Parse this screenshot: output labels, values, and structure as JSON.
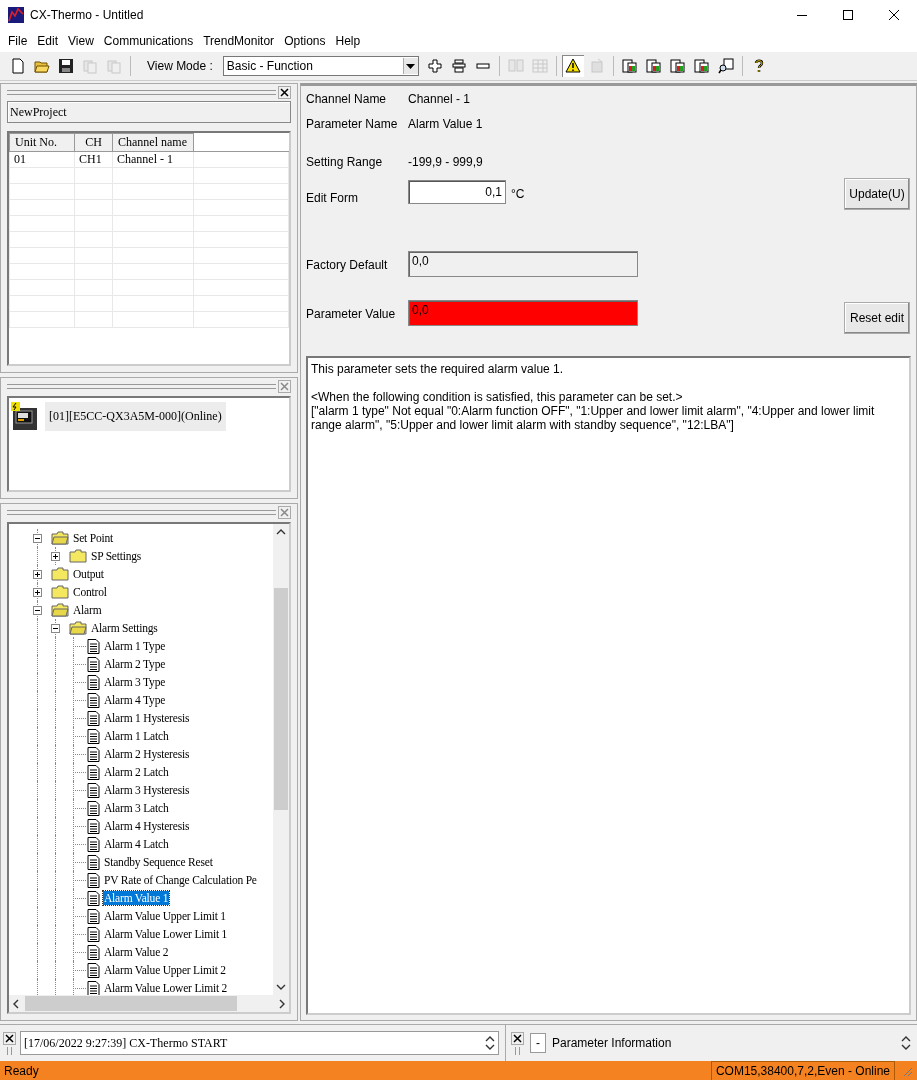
{
  "window": {
    "title": "CX-Thermo - Untitled"
  },
  "menu": [
    {
      "label": "File"
    },
    {
      "label": "Edit"
    },
    {
      "label": "View"
    },
    {
      "label": "Communications"
    },
    {
      "label": "TrendMonitor"
    },
    {
      "label": "Options"
    },
    {
      "label": "Help"
    }
  ],
  "toolbar": {
    "left": [
      {
        "kind": "new",
        "disabled": false
      },
      {
        "kind": "open",
        "disabled": false
      },
      {
        "kind": "save",
        "disabled": false
      },
      {
        "kind": "copy",
        "disabled": true
      },
      {
        "kind": "paste",
        "disabled": true
      }
    ],
    "view_mode_label": "View Mode :",
    "view_mode": "Basic - Function",
    "right": [
      {
        "kind": "plus",
        "disabled": false
      },
      {
        "kind": "stack",
        "disabled": false
      },
      {
        "kind": "minus",
        "disabled": false
      },
      {
        "kind": "split",
        "disabled": true
      },
      {
        "kind": "grid",
        "disabled": true
      },
      {
        "kind": "warning",
        "disabled": false
      },
      {
        "kind": "chip",
        "disabled": true
      },
      {
        "kind": "doc",
        "disabled": false
      },
      {
        "kind": "doc",
        "disabled": false
      },
      {
        "kind": "doc",
        "disabled": false
      },
      {
        "kind": "doc",
        "disabled": false
      },
      {
        "kind": "find",
        "disabled": false
      },
      {
        "kind": "help",
        "disabled": false
      }
    ]
  },
  "project": {
    "name": "NewProject"
  },
  "unit_table": {
    "columns": [
      "Unit No.",
      "CH",
      "Channel name"
    ],
    "rows": [
      [
        "01",
        "CH1",
        "Channel - 1"
      ]
    ]
  },
  "device": {
    "label": "[01][E5CC-QX3A5M-000](Online)"
  },
  "tree": [
    {
      "label": "Set Point",
      "expanded": true,
      "selected": false,
      "children": [
        {
          "label": "SP Settings",
          "expanded": false,
          "selected": false
        }
      ]
    },
    {
      "label": "Output",
      "expanded": false,
      "selected": false
    },
    {
      "label": "Control",
      "expanded": false,
      "selected": false
    },
    {
      "label": "Alarm",
      "expanded": true,
      "selected": false,
      "children": [
        {
          "label": "Alarm Settings",
          "expanded": true,
          "selected": false,
          "children": [
            {
              "label": "Alarm 1 Type",
              "selected": false
            },
            {
              "label": "Alarm 2 Type",
              "selected": false
            },
            {
              "label": "Alarm 3 Type",
              "selected": false
            },
            {
              "label": "Alarm 4 Type",
              "selected": false
            },
            {
              "label": "Alarm 1 Hysteresis",
              "selected": false
            },
            {
              "label": "Alarm 1 Latch",
              "selected": false
            },
            {
              "label": "Alarm 2 Hysteresis",
              "selected": false
            },
            {
              "label": "Alarm 2 Latch",
              "selected": false
            },
            {
              "label": "Alarm 3 Hysteresis",
              "selected": false
            },
            {
              "label": "Alarm 3 Latch",
              "selected": false
            },
            {
              "label": "Alarm 4 Hysteresis",
              "selected": false
            },
            {
              "label": "Alarm 4 Latch",
              "selected": false
            },
            {
              "label": "Standby Sequence Reset",
              "selected": false
            },
            {
              "label": "PV Rate of Change Calculation Pe",
              "selected": false
            },
            {
              "label": "Alarm Value 1",
              "selected": true
            },
            {
              "label": "Alarm Value Upper Limit 1",
              "selected": false
            },
            {
              "label": "Alarm Value Lower Limit 1",
              "selected": false
            },
            {
              "label": "Alarm Value 2",
              "selected": false
            },
            {
              "label": "Alarm Value Upper Limit 2",
              "selected": false
            },
            {
              "label": "Alarm Value Lower Limit 2",
              "selected": false
            }
          ]
        }
      ]
    }
  ],
  "parameter_fields": [
    {
      "kind": "text",
      "label": "Channel Name",
      "value": "Channel - 1"
    },
    {
      "kind": "text",
      "label": "Parameter Name",
      "value": "Alarm Value 1"
    },
    {
      "kind": "text",
      "label": "Setting Range",
      "value": "-199,9 - 999,9"
    },
    {
      "kind": "input",
      "label": "Edit Form",
      "value": "0,1",
      "unit": "°C",
      "button": "Update(U)"
    },
    {
      "kind": "readonly",
      "label": "Factory Default",
      "value": "0,0",
      "highlighted": false
    },
    {
      "kind": "readonly",
      "label": "Parameter Value",
      "value": "0,0",
      "highlighted": true,
      "button": "Reset edit"
    }
  ],
  "description": [
    "This parameter sets the required alarm value 1.",
    "<When the following condition is satisfied, this parameter can be set.>",
    "[\"alarm 1 type\" Not equal \"0:Alarm function OFF\", \"1:Upper and lower limit alarm\", \"4:Upper and lower limit range alarm\", \"5:Upper and lower limit alarm with standby sequence\", \"12:LBA\"]"
  ],
  "log": {
    "entry": "[17/06/2022 9:27:39] CX-Thermo START"
  },
  "info_pane": {
    "toggle": "-",
    "title": "Parameter Information"
  },
  "status_bar": {
    "text": "Ready",
    "connection": "COM15,38400,7,2,Even - Online"
  }
}
